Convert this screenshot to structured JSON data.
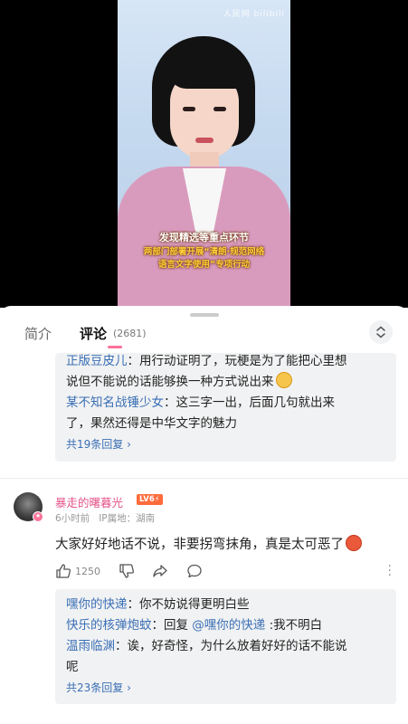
{
  "video": {
    "watermark": "人民网 bilibili",
    "caption_line1": "发现精选等重点环节",
    "caption_line2": "两部门部署开展“清朗·规范网络",
    "caption_line3": "语言文字使用”专项行动"
  },
  "tabs": {
    "intro_label": "简介",
    "comments_label": "评论",
    "comments_count": "(2681)"
  },
  "reply_box_1": {
    "replies": [
      {
        "name": "正版豆皮儿",
        "text": "：用行动证明了，玩梗是为了能把心里想"
      },
      {
        "name": "",
        "text": "说但不能说的话能够换一种方式说出来"
      },
      {
        "name": "某不知名战锤少女",
        "text": "：这三字一出，后面几句就出来"
      },
      {
        "name": "",
        "text": "了，果然还得是中华文字的魅力"
      }
    ],
    "more_label": "共19条回复 ›"
  },
  "comment": {
    "username": "暴走的曙暮光",
    "level": "LV6⚡",
    "time": "6小时前",
    "location": "IP属地：湖南",
    "text": "大家好好地话不说，非要拐弯抹角，真是太可恶了",
    "likes": "1250"
  },
  "reply_box_2": {
    "replies": [
      {
        "name": "嘿你的快递",
        "text": "：你不妨说得更明白些"
      },
      {
        "name": "快乐的核弹炮蚊",
        "text": "：回复 ",
        "mention": "@嘿你的快递",
        "tail": " :我不明白"
      },
      {
        "name": "温雨临渊",
        "text": "：诶，好奇怪，为什么放着好好的话不能说"
      },
      {
        "name": "",
        "text": "呢"
      }
    ],
    "more_label": "共23条回复 ›"
  },
  "icons": {
    "like": "thumbs-up-icon",
    "dislike": "thumbs-down-icon",
    "share": "share-icon",
    "reply": "chat-bubble-icon",
    "more": "more-vertical-icon",
    "expand": "expand-icon"
  },
  "colors": {
    "accent_pink": "#fb7299",
    "reply_name_blue": "#3a6fb5",
    "username_pink": "#e4558b",
    "level_orange": "#ff6b3b"
  }
}
